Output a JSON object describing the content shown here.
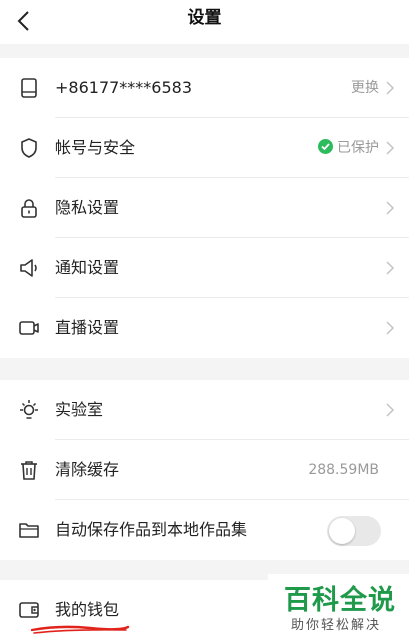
{
  "header": {
    "title": "设置"
  },
  "account": {
    "phone": {
      "label": "+86177****6583",
      "action": "更换"
    },
    "security": {
      "label": "帐号与安全",
      "status": "已保护"
    },
    "privacy": {
      "label": "隐私设置"
    },
    "notify": {
      "label": "通知设置"
    },
    "live": {
      "label": "直播设置"
    }
  },
  "general": {
    "lab": {
      "label": "实验室"
    },
    "cache": {
      "label": "清除缓存",
      "value": "288.59MB"
    },
    "autosave": {
      "label": "自动保存作品到本地作品集",
      "enabled": false
    }
  },
  "wallet": {
    "label": "我的钱包"
  },
  "watermark": {
    "title": "百科全说",
    "subtitle": "助你轻松解决"
  },
  "colors": {
    "ok": "#2dbb5d",
    "annotation": "#e0241b",
    "brand": "#1f9a4b"
  }
}
